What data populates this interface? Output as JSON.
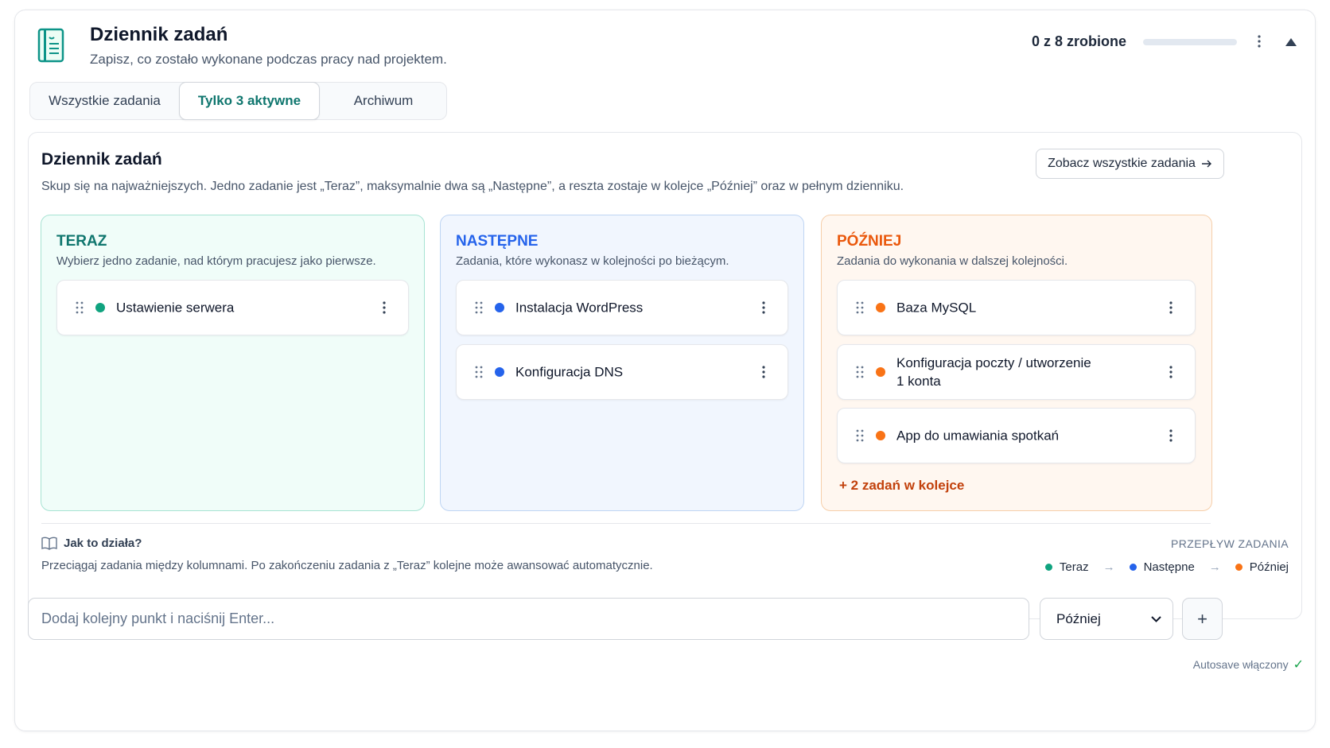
{
  "header": {
    "title": "Dziennik zadań",
    "subtitle": "Zapisz, co zostało wykonane podczas pracy nad projektem.",
    "progress_text": "0 z 8 zrobione",
    "progress_fraction": 0,
    "icon": "journal-icon"
  },
  "tabs": [
    {
      "label": "Wszystkie zadania",
      "active": false
    },
    {
      "label": "Tylko 3 aktywne",
      "active": true
    },
    {
      "label": "Archiwum",
      "active": false
    }
  ],
  "board": {
    "title": "Dziennik zadań",
    "subtitle": "Skup się na najważniejszych. Jedno zadanie jest „Teraz”, maksymalnie dwa są „Następne”, a reszta zostaje w kolejce „Później” oraz w pełnym dzienniku.",
    "view_all_label": "Zobacz wszystkie zadania"
  },
  "columns": {
    "now": {
      "title": "TERAZ",
      "subtitle": "Wybierz jedno zadanie, nad którym pracujesz jako pierwsze.",
      "color": "#10a37f",
      "tasks": [
        "Ustawienie serwera"
      ]
    },
    "next": {
      "title": "NASTĘPNE",
      "subtitle": "Zadania, które wykonasz w kolejności po bieżącym.",
      "color": "#2563eb",
      "tasks": [
        "Instalacja WordPress",
        "Konfiguracja DNS"
      ]
    },
    "later": {
      "title": "PÓŹNIEJ",
      "subtitle": "Zadania do wykonania w dalszej kolejności.",
      "color": "#f97316",
      "tasks": [
        "Baza MySQL",
        "Konfiguracja poczty / utworzenie 1 konta",
        "App do umawiania spotkań"
      ],
      "more_label": "+ 2 zadań w kolejce"
    }
  },
  "help": {
    "title": "Jak to działa?",
    "text": "Przeciągaj zadania między kolumnami. Po zakończeniu zadania z „Teraz” kolejne może awansować automatycznie.",
    "flow_title": "PRZEPŁYW ZADANIA",
    "flow": [
      "Teraz",
      "Następne",
      "Później"
    ]
  },
  "add": {
    "placeholder": "Dodaj kolejny punkt i naciśnij Enter...",
    "select_value": "Później",
    "add_button": "+"
  },
  "autosave": "Autosave włączony"
}
